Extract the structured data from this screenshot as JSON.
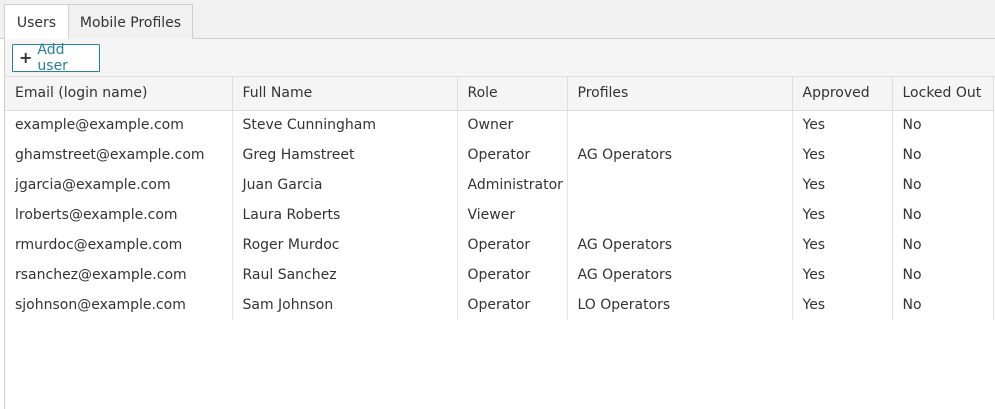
{
  "tabs": [
    {
      "label": "Users",
      "active": true
    },
    {
      "label": "Mobile Profiles",
      "active": false
    }
  ],
  "toolbar": {
    "add_label": "Add user",
    "add_icon": "plus-icon"
  },
  "table": {
    "columns": [
      "Email (login name)",
      "Full Name",
      "Role",
      "Profiles",
      "Approved",
      "Locked Out"
    ],
    "rows": [
      [
        "example@example.com",
        "Steve Cunningham",
        "Owner",
        "",
        "Yes",
        "No"
      ],
      [
        "ghamstreet@example.com",
        "Greg Hamstreet",
        "Operator",
        "AG Operators",
        "Yes",
        "No"
      ],
      [
        "jgarcia@example.com",
        "Juan Garcia",
        "Administrator",
        "",
        "Yes",
        "No"
      ],
      [
        "lroberts@example.com",
        "Laura Roberts",
        "Viewer",
        "",
        "Yes",
        "No"
      ],
      [
        "rmurdoc@example.com",
        "Roger Murdoc",
        "Operator",
        "AG Operators",
        "Yes",
        "No"
      ],
      [
        "rsanchez@example.com",
        "Raul Sanchez",
        "Operator",
        "AG Operators",
        "Yes",
        "No"
      ],
      [
        "sjohnson@example.com",
        "Sam Johnson",
        "Operator",
        "LO Operators",
        "Yes",
        "No"
      ]
    ]
  },
  "colors": {
    "accent": "#2a7f9a",
    "border": "#cfcfcf",
    "header_bg": "#f5f5f5"
  }
}
